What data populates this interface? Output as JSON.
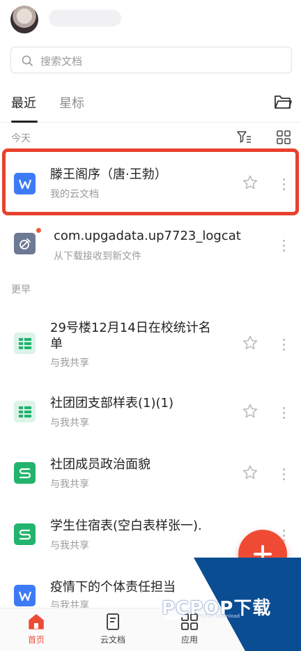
{
  "search": {
    "placeholder": "搜索文档"
  },
  "tabs": [
    {
      "label": "最近"
    },
    {
      "label": "星标"
    }
  ],
  "sections": {
    "today": "今天",
    "earlier": "更早"
  },
  "files": [
    {
      "title": "滕王阁序（唐·王勃）",
      "subtitle": "我的云文档",
      "icon": "word-doc-icon",
      "color": "#3d7bf6"
    },
    {
      "title": "com.upgadata.up7723_logcat",
      "subtitle": "从下载接收到新文件",
      "icon": "unknown-file-icon",
      "color": "#6d7a94"
    },
    {
      "title": "29号楼12月14日在校统计名单",
      "title_line1": "29号楼12月14日在校统计名",
      "title_line2": "单",
      "subtitle": "与我共享",
      "icon": "sheet-doc-icon",
      "color": "#1fb46f"
    },
    {
      "title": "社团团支部样表(1)(1)",
      "subtitle": "与我共享",
      "icon": "sheet-doc-icon",
      "color": "#1fb46f"
    },
    {
      "title": "社团成员政治面貌",
      "subtitle": "与我共享",
      "icon": "sheet-s-icon",
      "color": "#22b46c"
    },
    {
      "title": "学生住宿表(空白表样张一).",
      "subtitle": "与我共享",
      "icon": "sheet-s-icon",
      "color": "#22b46c"
    },
    {
      "title": "疫情下的个体责任担当",
      "subtitle": "与我共享",
      "icon": "word-doc-icon",
      "color": "#3d7bf6"
    }
  ],
  "bottom_nav": [
    {
      "label": "首页",
      "icon": "home-icon",
      "active": true
    },
    {
      "label": "云文档",
      "icon": "cloud-doc-icon",
      "active": false
    },
    {
      "label": "应用",
      "icon": "apps-icon",
      "active": false
    }
  ],
  "watermark": {
    "text": "PCPOP下载",
    "sub": "PCPOP Download"
  },
  "colors": {
    "accent": "#ef4b34",
    "highlight": "#e8412c",
    "word": "#3d7bf6",
    "sheet": "#1fb46f"
  }
}
